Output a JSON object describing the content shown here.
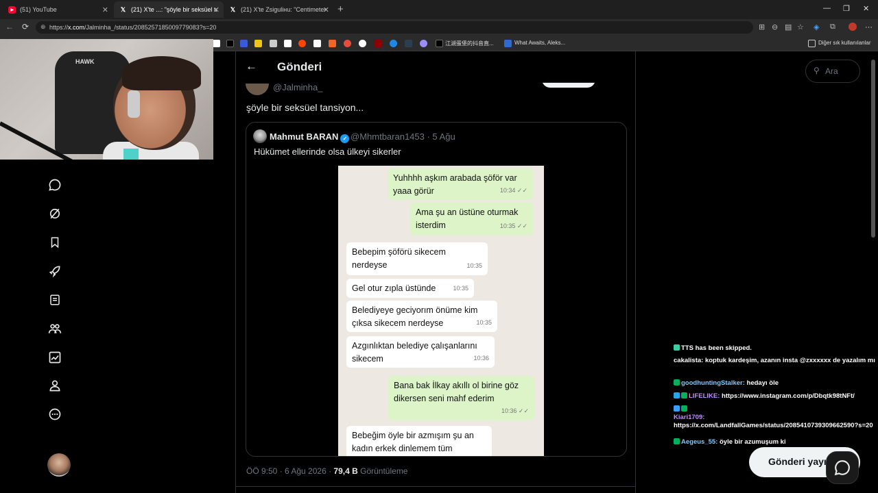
{
  "browser": {
    "tabs": [
      {
        "label": "(51) YouTube",
        "icon": "youtube-icon"
      },
      {
        "label": "(21) X'te ...: \"şöyle bir seksüel tansi",
        "icon": "x-logo-icon"
      },
      {
        "label": "(21) X'te Zsiguliнu: \"Centimeters f",
        "icon": "x-logo-icon"
      }
    ],
    "url_prefix": "https://",
    "url_domain": "x.com",
    "url_path": "/Jalminha_/status/2085257185009779083?s=20",
    "bookmarks": {
      "text_item_1": "江湖蛋堡的抖音直...",
      "text_item_2": "What Awaits, Aleks...",
      "other_bookmarks": "Diğer sık kullanılanlar"
    }
  },
  "header": {
    "title": "Gönderi"
  },
  "post": {
    "author_handle": "@Jalminha_",
    "text": "şöyle bir seksüel tansiyon...",
    "timestamp": "ÖÖ 9:50 · 6 Ağu 2026 · ",
    "views_count": "79,4 B",
    "views_label": " Görüntüleme"
  },
  "quoted": {
    "name": "Mahmut BARAN",
    "handle_date": "@Mhmtbaran1453 · 5 Ağu",
    "text": "Hükümet ellerinde olsa ülkeyi sikerler",
    "chat": [
      {
        "dir": "out",
        "text": "Yuhhhh aşkım arabada şöför var yaaa görür",
        "time": "10:34 ✓✓"
      },
      {
        "dir": "out",
        "text": "Ama şu an üstüne oturmak isterdim",
        "time": "10:35 ✓✓"
      },
      {
        "dir": "in",
        "text": "Bebepim şöförü sikecem nerdeyse",
        "time": "10:35"
      },
      {
        "dir": "in",
        "text": "Gel otur zıpla üstünde",
        "time": "10:35"
      },
      {
        "dir": "in",
        "text": "Belediyeye geciyorım önüme kim çıksa sikecem nerdeyse",
        "time": "10:35"
      },
      {
        "dir": "in",
        "text": "Azgınlıktan belediye çalışanlarını sikecem",
        "time": "10:36"
      },
      {
        "dir": "out",
        "text": "Bana bak İlkay akıllı ol birine göz dikersen seni mahf ederim",
        "time": "10:36 ✓✓"
      },
      {
        "dir": "in",
        "text": "Bebeğim öyle bir azmışım şu an kadın erkek dinlemem tüm",
        "time": ""
      }
    ]
  },
  "search": {
    "placeholder": "Ara"
  },
  "compose_label": "Gönderi yayı",
  "stream_chat": [
    {
      "user": "",
      "text": "TTS has been skipped.",
      "user_color": "#ff4d4d"
    },
    {
      "user": "cakalista:",
      "text": " koptuk kardeşim, azanın insta @zxxxxxx de yazalım mı",
      "user_color": "#ffffff"
    },
    {
      "user": "goodhuntingStalker:",
      "text": " hedayı öle",
      "user_color": "#7ec8ff"
    },
    {
      "user": "LIFELIKE:",
      "text": " https://www.instagram.com/p/Dbqtk98tNFt/",
      "user_color": "#c28bff"
    },
    {
      "user": "Kiari1709:",
      "text": " https://x.com/LandfallGames/status/2085410739309662590?s=20",
      "user_color": "#c28bff"
    },
    {
      "user": "Aegeus_55:",
      "text": " öyle bir azumuşum ki",
      "user_color": "#7ec8ff"
    }
  ],
  "colors": {
    "accent": "#1d9bf0",
    "background": "#000000",
    "border": "#2f3336",
    "muted": "#71767b"
  }
}
